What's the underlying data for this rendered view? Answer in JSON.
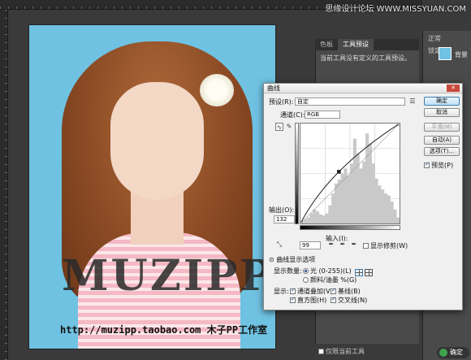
{
  "watermark": "思缘设计论坛 WWW.MISSYUAN.COM",
  "canvas": {
    "brand": "MUZIPP",
    "url_text": "http://muzipp.taobao.com 木子PP工作室"
  },
  "properties_panel": {
    "tabs": [
      "色板",
      "工具预设"
    ],
    "message": "当前工具没有定义的工具预设。",
    "bottom_label": "仅限当前工具"
  },
  "layers_panel": {
    "tab": "正常",
    "lock_label": "锁定:",
    "layer_name": "背景"
  },
  "dialog": {
    "title": "曲线",
    "preset_label": "预设(R):",
    "preset_value": "自定",
    "channel_label": "通道(C):",
    "channel_value": "RGB",
    "output_label": "输出(O):",
    "output_value": "132",
    "input_label": "输入(I):",
    "input_value": "99",
    "show_clipping_label": "显示修剪(W)",
    "display_options_label": "曲线显示选项",
    "show_amount_label": "显示数量:",
    "light_option": "光 (0-255)(L)",
    "pigment_option": "颜料/油墨 %(G)",
    "show_label": "显示:",
    "channel_overlays": "通道叠加(V)",
    "baseline": "基线(B)",
    "histogram": "直方图(H)",
    "intersection": "交叉线(N)",
    "buttons": {
      "ok": "确定",
      "cancel": "取消",
      "smooth": "平滑(M)",
      "auto": "自动(A)",
      "options": "选项(T)...",
      "preview": "预览(P)"
    }
  },
  "status_badge": "确定",
  "chart_data": {
    "type": "line",
    "title": "",
    "xlabel": "",
    "ylabel": "",
    "xlim": [
      0,
      255
    ],
    "ylim": [
      0,
      255
    ],
    "series": [
      {
        "values": [
          [
            0,
            0
          ],
          [
            99,
            132
          ],
          [
            255,
            255
          ]
        ]
      }
    ],
    "baseline": [
      [
        0,
        0
      ],
      [
        255,
        255
      ]
    ],
    "histogram": [
      2,
      4,
      6,
      10,
      14,
      12,
      9,
      8,
      10,
      18,
      30,
      40,
      44,
      50,
      55,
      48,
      60,
      85,
      70,
      55,
      62,
      90,
      80,
      60,
      45,
      38,
      34,
      30,
      28,
      22,
      14,
      6
    ],
    "grid": true
  }
}
